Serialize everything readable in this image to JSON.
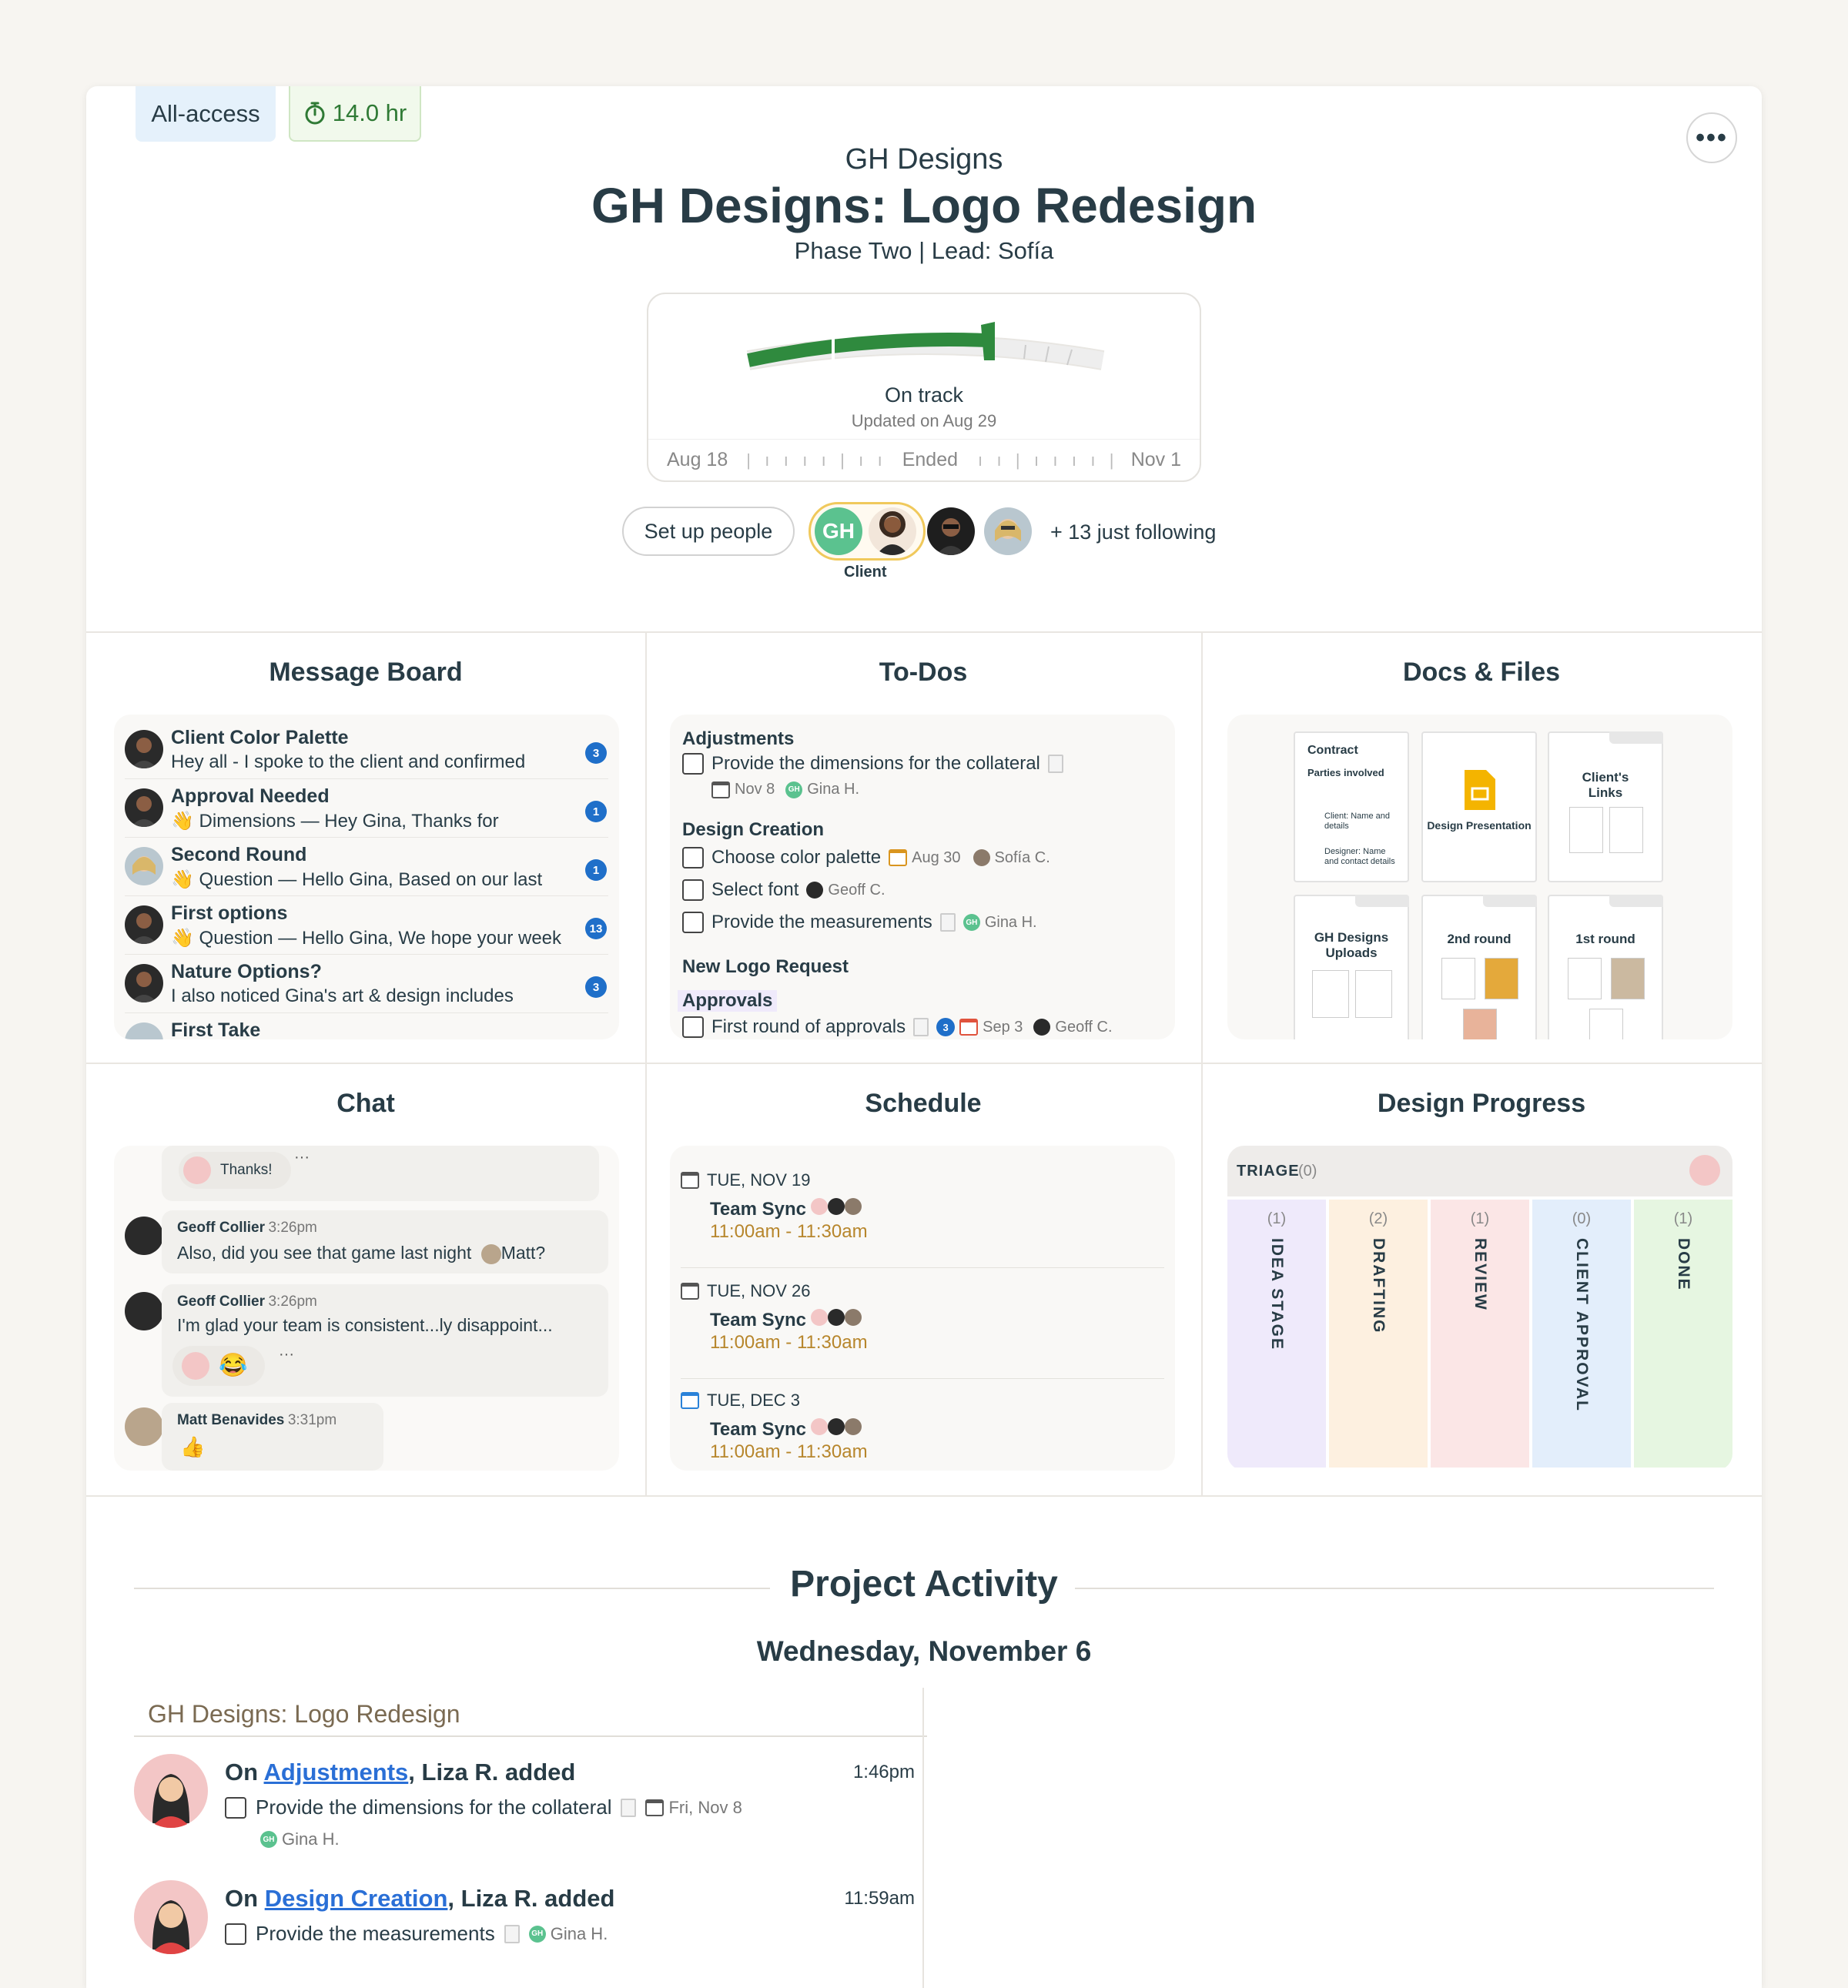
{
  "badges": {
    "access": "All-access",
    "hours": "14.0 hr"
  },
  "header": {
    "company": "GH Designs",
    "title": "GH Designs: Logo Redesign",
    "subtitle": "Phase Two | Lead: Sofía"
  },
  "hill_chart": {
    "status": "On track",
    "updated": "Updated on Aug 29",
    "start": "Aug 18",
    "middle": "Ended",
    "end": "Nov 1",
    "progress": 0.7
  },
  "people": {
    "setup_label": "Set up people",
    "client_initials": "GH",
    "client_label": "Client",
    "following": "+ 13 just following"
  },
  "message_board": {
    "title": "Message Board",
    "items": [
      {
        "title": "Client Color Palette",
        "preview": "Hey all - I spoke to the client and confirmed",
        "count": "3"
      },
      {
        "title": "Approval Needed",
        "preview": "👋 Dimensions — Hey Gina, Thanks for",
        "count": "1"
      },
      {
        "title": "Second Round",
        "preview": "👋 Question — Hello Gina, Based on our last",
        "count": "1"
      },
      {
        "title": "First options",
        "preview": "👋 Question — Hello Gina, We hope your week",
        "count": "13"
      },
      {
        "title": "Nature Options?",
        "preview": "I also noticed Gina's art & design includes",
        "count": "3"
      },
      {
        "title": "First Take",
        "preview": "",
        "count": ""
      }
    ]
  },
  "todos": {
    "title": "To-Dos",
    "groups": {
      "adjustments": "Adjustments",
      "design_creation": "Design Creation",
      "new_logo": "New Logo Request",
      "approvals": "Approvals"
    },
    "items": {
      "dimensions": "Provide the dimensions for the collateral",
      "dimensions_date": "Nov 8",
      "dimensions_person": "Gina H.",
      "palette": "Choose color palette",
      "palette_date": "Aug 30",
      "palette_person": "Sofía C.",
      "font": "Select font",
      "font_person": "Geoff C.",
      "measurements": "Provide the measurements",
      "measurements_person": "Gina H.",
      "approvals": "First round of approvals",
      "approvals_count": "3",
      "approvals_date": "Sep 3",
      "approvals_person": "Geoff C."
    }
  },
  "docs": {
    "title": "Docs & Files",
    "contract_title": "Contract",
    "contract_line1": "Parties involved",
    "contract_line2": "Client: Name and details",
    "contract_line3": "Designer: Name and contact details",
    "design_presentation": "Design Presentation",
    "clients_links": "Client's Links",
    "uploads": "GH Designs Uploads",
    "second_round": "2nd round",
    "first_round": "1st round"
  },
  "chat": {
    "title": "Chat",
    "thanks": "Thanks!",
    "msg1_name": "Geoff Collier",
    "msg1_time": "3:26pm",
    "msg1_text": "Also, did you see that game last night",
    "msg1_mention": "Matt?",
    "msg2_name": "Geoff Collier",
    "msg2_time": "3:26pm",
    "msg2_text": "I'm glad your team is consistent...ly disappoint...",
    "msg3_name": "Matt Benavides",
    "msg3_time": "3:31pm"
  },
  "schedule": {
    "title": "Schedule",
    "events": [
      {
        "day": "TUE, NOV 19",
        "name": "Team Sync",
        "time": "11:00am - 11:30am"
      },
      {
        "day": "TUE, NOV 26",
        "name": "Team Sync",
        "time": "11:00am - 11:30am"
      },
      {
        "day": "TUE, DEC 3",
        "name": "Team Sync",
        "time": "11:00am - 11:30am"
      }
    ]
  },
  "design_progress": {
    "title": "Design Progress",
    "triage": "TRIAGE",
    "triage_count": "(0)",
    "columns": [
      {
        "label": "IDEA STAGE",
        "count": "(1)",
        "color": "#efeafb"
      },
      {
        "label": "DRAFTING",
        "count": "(2)",
        "color": "#fdf0e0"
      },
      {
        "label": "REVIEW",
        "count": "(1)",
        "color": "#fbe6e6"
      },
      {
        "label": "CLIENT APPROVAL",
        "count": "(0)",
        "color": "#e3eefb"
      },
      {
        "label": "DONE",
        "count": "(1)",
        "color": "#e6f6e1"
      }
    ]
  },
  "activity": {
    "title": "Project Activity",
    "date": "Wednesday, November 6",
    "project": "GH Designs: Logo Redesign",
    "entries": [
      {
        "prefix": "On",
        "list": "Adjustments",
        "suffix": ", Liza R. added",
        "time": "1:46pm",
        "item": "Provide the dimensions for the collateral",
        "due": "Fri, Nov 8",
        "assignee": "Gina H."
      },
      {
        "prefix": "On",
        "list": "Design Creation",
        "suffix": ", Liza R. added",
        "time": "11:59am",
        "item": "Provide the measurements",
        "assignee": "Gina H."
      }
    ]
  },
  "colors": {
    "accent_green": "#2f8a3e",
    "badge_blue": "#1f6fc9",
    "link_blue": "#2a6fd6",
    "time_gold": "#b7862c"
  }
}
